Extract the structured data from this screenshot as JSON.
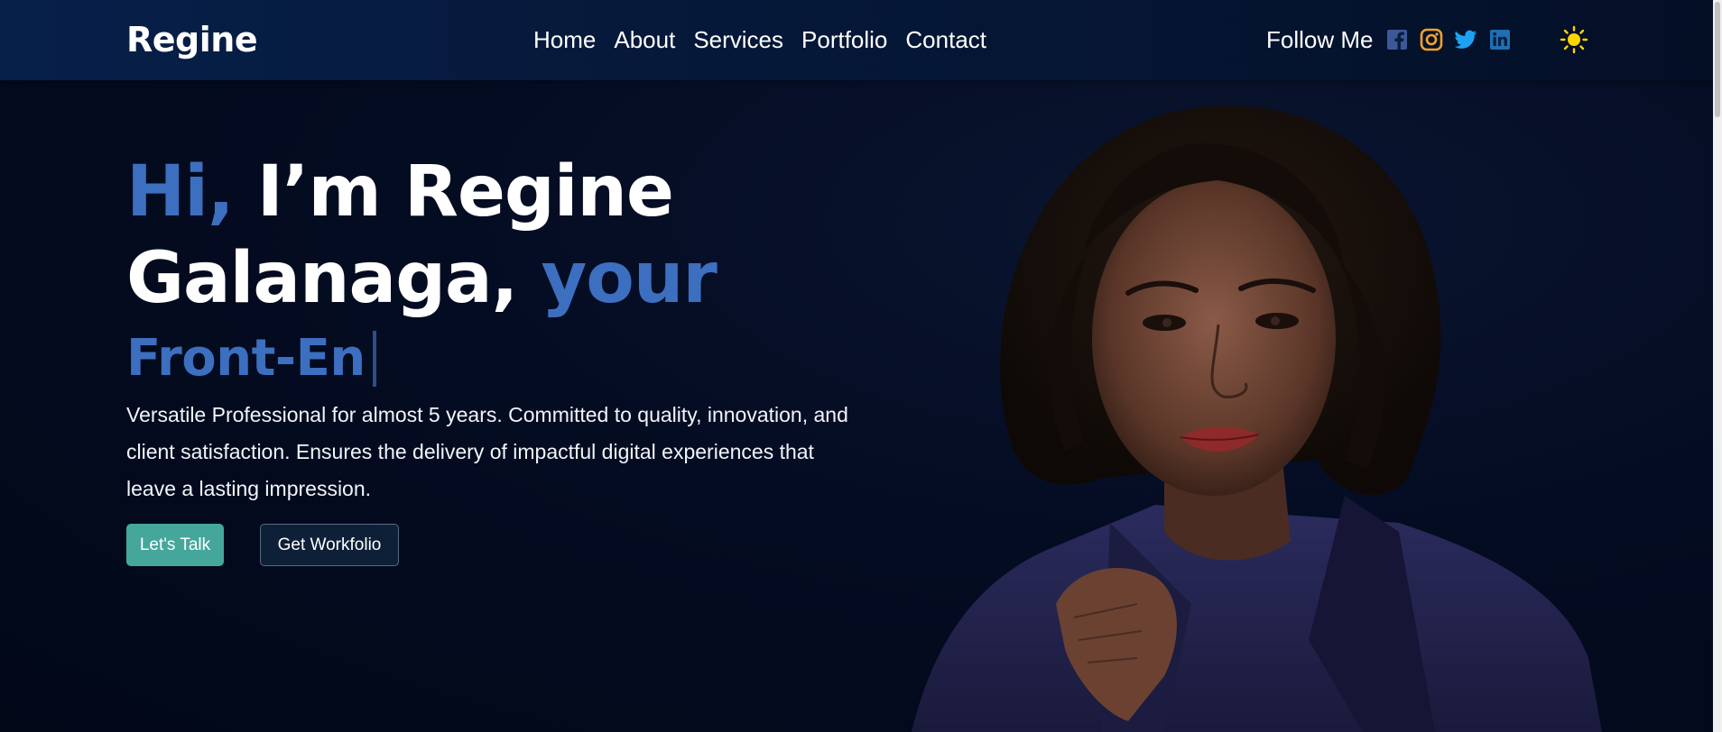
{
  "nav": {
    "brand": "Regine",
    "links": [
      "Home",
      "About",
      "Services",
      "Portfolio",
      "Contact"
    ],
    "follow_label": "Follow Me",
    "socials": [
      "facebook-icon",
      "instagram-icon",
      "twitter-icon",
      "linkedin-icon"
    ],
    "theme_icon": "sun-icon"
  },
  "hero": {
    "title_hi": "Hi,",
    "title_name": " I’m Regine Galanaga,",
    "title_your": " your",
    "typed_text": "Front-En",
    "description": "Versatile Professional for almost 5 years. Committed to quality, innovation, and client satisfaction. Ensures the delivery of impactful digital experiences that leave a lasting impression.",
    "btn_talk": "Let's Talk",
    "btn_workfolio": "Get Workfolio"
  },
  "colors": {
    "accent": "#3d6fc0",
    "button_primary": "#45a79c",
    "background": "#030b1f",
    "navbar": "#061a3d",
    "sun": "#ffd500"
  }
}
